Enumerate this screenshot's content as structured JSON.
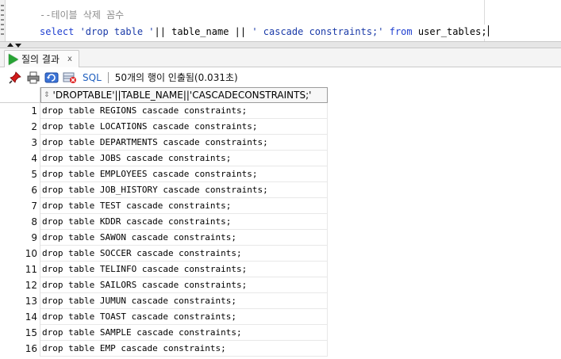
{
  "editor": {
    "comment_line": "--테이블 삭제 꼼수",
    "sql_tokens": [
      {
        "t": "select ",
        "k": "kw"
      },
      {
        "t": "'drop table '",
        "k": "str"
      },
      {
        "t": "|| table_name || ",
        "k": "plain"
      },
      {
        "t": "' cascade constraints;'",
        "k": "str"
      },
      {
        "t": " ",
        "k": "plain"
      },
      {
        "t": "from",
        "k": "kw"
      },
      {
        "t": " user_tables;",
        "k": "plain"
      }
    ]
  },
  "result_tab": {
    "label": "질의 결과",
    "close": "x"
  },
  "toolbar": {
    "sql_label": "SQL",
    "status": "50개의 행이 인출됨(0.031초)"
  },
  "grid": {
    "column_header": "'DROPTABLE'||TABLE_NAME||'CASCADECONSTRAINTS;'",
    "rows": [
      {
        "n": "1",
        "v": "drop table REGIONS cascade constraints;"
      },
      {
        "n": "2",
        "v": "drop table LOCATIONS cascade constraints;"
      },
      {
        "n": "3",
        "v": "drop table DEPARTMENTS cascade constraints;"
      },
      {
        "n": "4",
        "v": "drop table JOBS cascade constraints;"
      },
      {
        "n": "5",
        "v": "drop table EMPLOYEES cascade constraints;"
      },
      {
        "n": "6",
        "v": "drop table JOB_HISTORY cascade constraints;"
      },
      {
        "n": "7",
        "v": "drop table TEST cascade constraints;"
      },
      {
        "n": "8",
        "v": "drop table KDDR cascade constraints;"
      },
      {
        "n": "9",
        "v": "drop table SAWON cascade constraints;"
      },
      {
        "n": "10",
        "v": "drop table SOCCER cascade constraints;"
      },
      {
        "n": "11",
        "v": "drop table TELINFO cascade constraints;"
      },
      {
        "n": "12",
        "v": "drop table SAILORS cascade constraints;"
      },
      {
        "n": "13",
        "v": "drop table JUMUN cascade constraints;"
      },
      {
        "n": "14",
        "v": "drop table TOAST cascade constraints;"
      },
      {
        "n": "15",
        "v": "drop table SAMPLE cascade constraints;"
      },
      {
        "n": "16",
        "v": "drop table EMP cascade constraints;"
      }
    ]
  },
  "icons": {
    "pin": "pin-icon",
    "print": "print-icon",
    "refresh": "refresh-icon",
    "delete": "delete-icon",
    "run": "run-triangle-icon",
    "sort": "sort-icon"
  }
}
